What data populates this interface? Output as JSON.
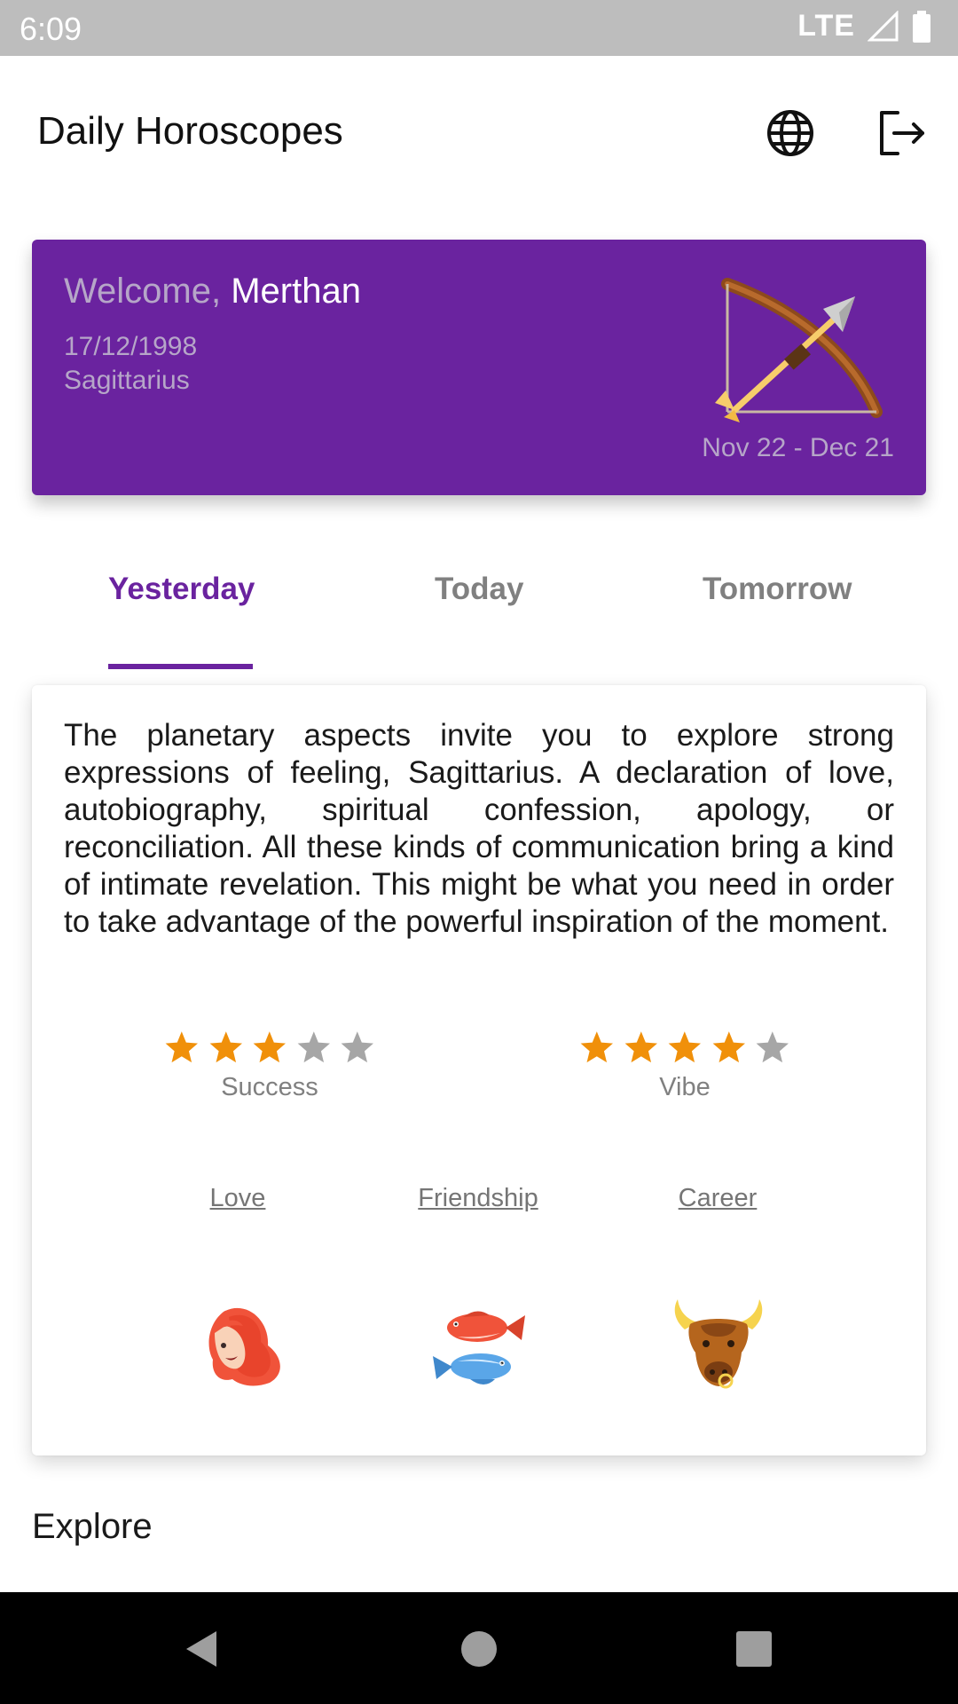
{
  "status": {
    "time": "6:09",
    "network": "LTE"
  },
  "app": {
    "title": "Daily Horoscopes",
    "icons": [
      "globe-icon",
      "logout-icon"
    ]
  },
  "welcome": {
    "prefix": "Welcome,",
    "name": "Merthan",
    "birth_date": "17/12/1998",
    "sign": "Sagittarius",
    "date_range": "Nov 22 - Dec 21",
    "sign_icon": "sagittarius-bow-arrow-icon"
  },
  "tabs": [
    {
      "label": "Yesterday",
      "active": true
    },
    {
      "label": "Today",
      "active": false
    },
    {
      "label": "Tomorrow",
      "active": false
    }
  ],
  "horoscope": {
    "text": "The planetary aspects invite you to explore strong expressions of feeling, Sagittarius. A declaration of love, autobiography, spiritual confession, apology, or reconciliation. All these kinds of communication bring a kind of intimate revelation. This might be what you need in order to take advantage of the powerful inspiration of the moment.",
    "ratings": [
      {
        "label": "Success",
        "value": 3,
        "max": 5
      },
      {
        "label": "Vibe",
        "value": 4,
        "max": 5
      }
    ],
    "categories": [
      {
        "label": "Love",
        "icon": "virgo-woman-icon"
      },
      {
        "label": "Friendship",
        "icon": "pisces-fish-icon"
      },
      {
        "label": "Career",
        "icon": "taurus-bull-icon"
      }
    ]
  },
  "explore": {
    "title": "Explore"
  },
  "colors": {
    "primary": "#6a239f",
    "star_filled": "#f0900a",
    "star_empty": "#a6a6a6",
    "status_bar": "#bdbdbd"
  }
}
